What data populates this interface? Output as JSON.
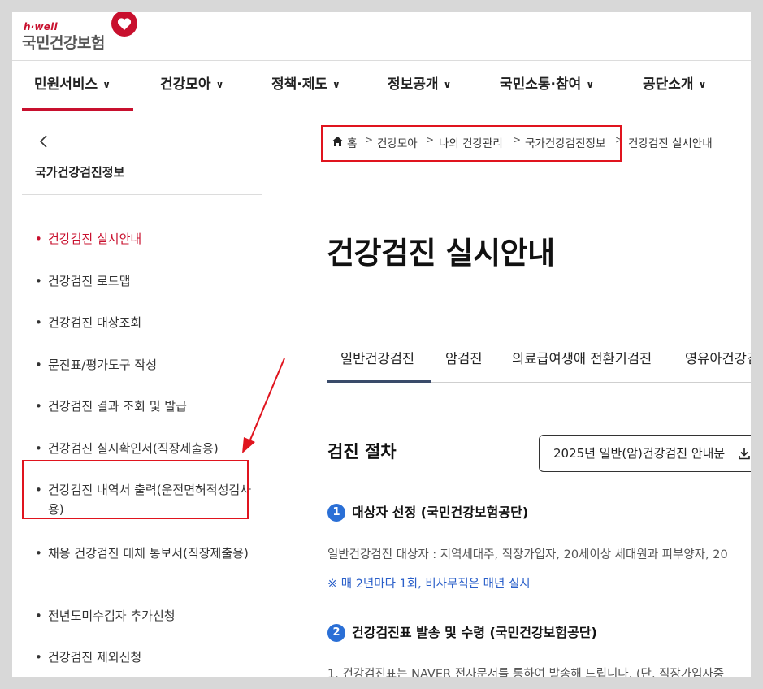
{
  "header": {
    "logo_top": "h·well",
    "logo_main": "국민건강보험"
  },
  "gnb": {
    "items": [
      {
        "label": "민원서비스"
      },
      {
        "label": "건강모아"
      },
      {
        "label": "정책·제도"
      },
      {
        "label": "정보공개"
      },
      {
        "label": "국민소통·참여"
      },
      {
        "label": "공단소개"
      }
    ]
  },
  "sidebar": {
    "title": "국가건강검진정보",
    "items": [
      {
        "label": "건강검진 실시안내",
        "active": true
      },
      {
        "label": "건강검진 로드맵"
      },
      {
        "label": "건강검진 대상조회"
      },
      {
        "label": "문진표/평가도구 작성"
      },
      {
        "label": "건강검진 결과 조회 및 발급"
      },
      {
        "label": "건강검진 실시확인서(직장제출용)"
      },
      {
        "label": "건강검진 내역서 출력(운전면허적성검사용)"
      },
      {
        "label": "채용 건강검진 대체 통보서(직장제출용)"
      },
      {
        "label": "전년도미수검자 추가신청"
      },
      {
        "label": "건강검진 제외신청"
      }
    ]
  },
  "breadcrumb": {
    "items": [
      "홈",
      "건강모아",
      "나의 건강관리",
      "국가건강검진정보",
      "건강검진 실시안내"
    ]
  },
  "main": {
    "title": "건강검진 실시안내",
    "tabs": [
      "일반건강검진",
      "암검진",
      "의료급여생애 전환기검진",
      "영유아건강검"
    ],
    "section_title": "검진 절차",
    "guide_button": "2025년 일반(암)건강검진 안내문",
    "steps": [
      {
        "num": "1",
        "heading": "대상자 선정 (국민건강보험공단)",
        "text": "일반건강검진 대상자 : 지역세대주, 직장가입자, 20세이상 세대원과 피부양자, 20",
        "note": "※ 매 2년마다 1회, 비사무직은 매년 실시"
      },
      {
        "num": "2",
        "heading": "건강검진표 발송 및 수령 (국민건강보험공단)",
        "text": "1.  건강검진표는 NAVER 전자문서를 통하여 발송해 드립니다. (단, 직장가입자중"
      }
    ]
  },
  "colors": {
    "brand_red": "#c8102e",
    "annotation_red": "#e0141e",
    "step_blue": "#2a6fd6",
    "note_blue": "#2a5fc9"
  }
}
